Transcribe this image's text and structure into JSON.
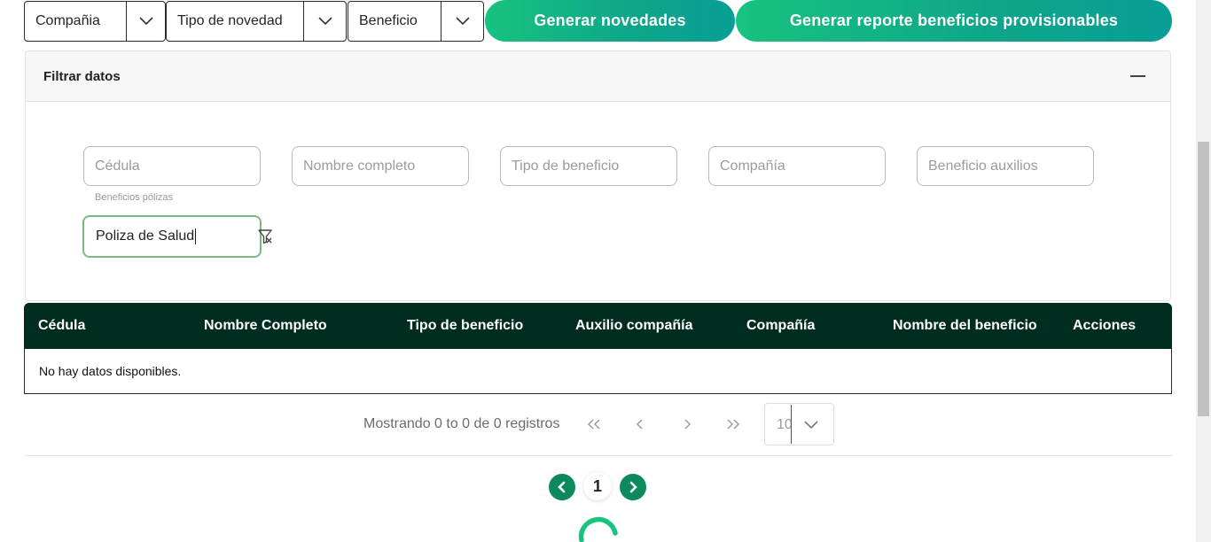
{
  "toolbar": {
    "company_dropdown": "Compañia",
    "novelty_type_dropdown": "Tipo de novedad",
    "benefit_dropdown": "Beneficio",
    "generate_news_button": "Generar novedades",
    "generate_report_button": "Generar reporte beneficios provisionables"
  },
  "filter": {
    "title": "Filtrar datos",
    "fields": {
      "cedula_placeholder": "Cédula",
      "nombre_placeholder": "Nombre completo",
      "tipo_placeholder": "Tipo de beneficio",
      "compania_placeholder": "Compañía",
      "auxilios_placeholder": "Beneficio auxilios"
    },
    "polizas_label": "Beneficios pólizas",
    "polizas_value": "Poliza de Salud"
  },
  "table": {
    "headers": [
      "Cédula",
      "Nombre Completo",
      "Tipo de beneficio",
      "Auxilio compañía",
      "Compañía",
      "Nombre del beneficio",
      "Acciones"
    ],
    "empty_message": "No hay datos disponibles."
  },
  "pagination": {
    "summary": "Mostrando 0 to 0 de 0 registros",
    "first": "«",
    "prev": "‹",
    "next": "›",
    "last": "»",
    "page_size": "10"
  },
  "pager": {
    "current_page": "1"
  },
  "colors": {
    "accent_green": "#18c27f",
    "teal": "#089e95",
    "header_dark": "#002d1f",
    "active_border": "#7cb97e",
    "pager_green": "#0c8a5b"
  }
}
